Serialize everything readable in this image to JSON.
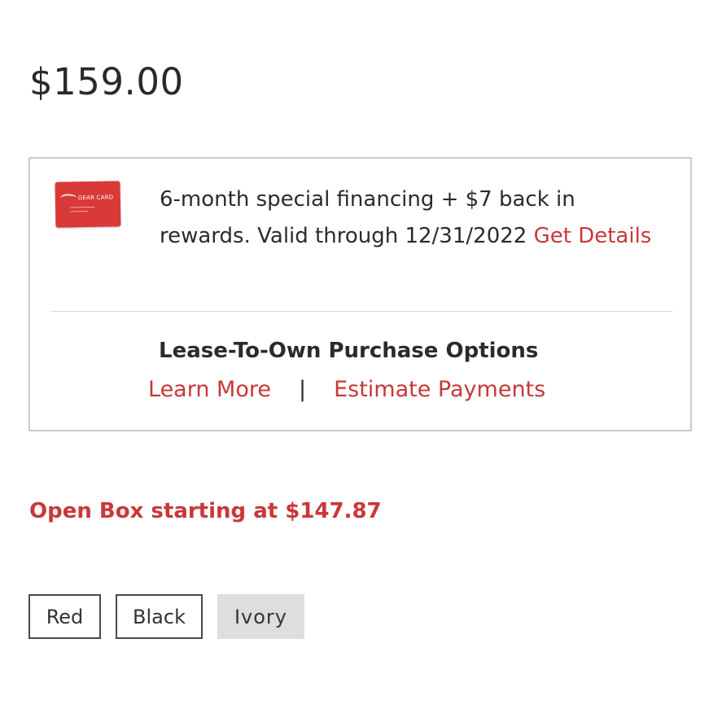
{
  "product": {
    "price": "$159.00"
  },
  "financing": {
    "card_image_label": "GEAR CARD",
    "offer_text": "6-month special financing + $7 back in rewards. Valid through 12/31/2022",
    "details_link": "Get Details"
  },
  "lease": {
    "title": "Lease-To-Own Purchase Options",
    "learn_more": "Learn More",
    "separator": "|",
    "estimate_payments": "Estimate Payments"
  },
  "open_box": {
    "label": "Open Box starting at $147.87"
  },
  "colors": {
    "accent": "#c8383a",
    "selected_swatch_bg": "#dedede",
    "options": [
      {
        "label": "Red",
        "selected": false
      },
      {
        "label": "Black",
        "selected": false
      },
      {
        "label": "Ivory",
        "selected": true
      }
    ]
  }
}
